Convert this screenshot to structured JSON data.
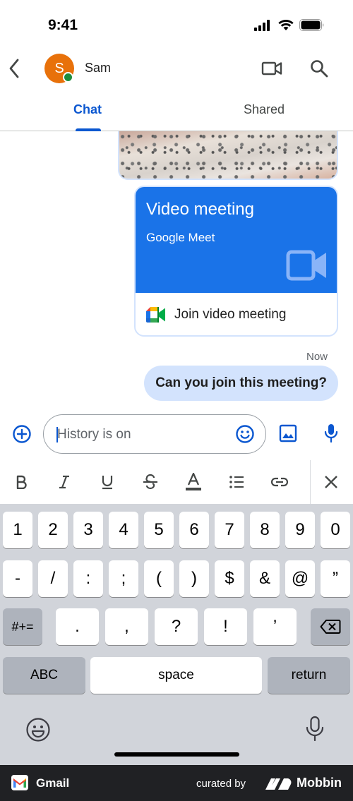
{
  "status_bar": {
    "time": "9:41",
    "icons": [
      "cellular-signal-icon",
      "wifi-icon",
      "battery-icon"
    ]
  },
  "header": {
    "back_icon": "chevron-left-icon",
    "avatar_letter": "S",
    "avatar_color": "#e8710a",
    "presence_color": "#1e8e3e",
    "contact_name": "Sam",
    "actions": [
      "video-call-icon",
      "search-icon"
    ]
  },
  "tabs": [
    {
      "label": "Chat",
      "selected": true
    },
    {
      "label": "Shared",
      "selected": false
    }
  ],
  "messages": {
    "meet_card": {
      "title": "Video meeting",
      "subtitle": "Google Meet",
      "join_label": "Join video meeting",
      "accent_color": "#1a73e8"
    },
    "timestamp": "Now",
    "text_message": "Can you join this meeting?"
  },
  "composer": {
    "placeholder": "History is on",
    "icons": [
      "add-circle-icon",
      "emoji-icon",
      "image-icon",
      "mic-icon"
    ]
  },
  "format_toolbar": {
    "items": [
      "bold-icon",
      "italic-icon",
      "underline-icon",
      "strikethrough-icon",
      "text-color-icon",
      "bulleted-list-icon",
      "link-icon",
      "close-icon"
    ]
  },
  "keyboard": {
    "row1": [
      "1",
      "2",
      "3",
      "4",
      "5",
      "6",
      "7",
      "8",
      "9",
      "0"
    ],
    "row2": [
      "-",
      "/",
      ":",
      ";",
      "(",
      ")",
      "$",
      "&",
      "@",
      "”"
    ],
    "row3": [
      ".",
      ",",
      "?",
      "!",
      "’"
    ],
    "shift_label": "#+=",
    "abc_label": "ABC",
    "space_label": "space",
    "return_label": "return"
  },
  "brand_bar": {
    "app_name": "Gmail",
    "curated_by": "curated by",
    "mobbin": "Mobbin"
  },
  "colors": {
    "primary": "#0b57d0",
    "bubble": "#d3e3fd",
    "keyboard_bg": "#d1d4da"
  }
}
